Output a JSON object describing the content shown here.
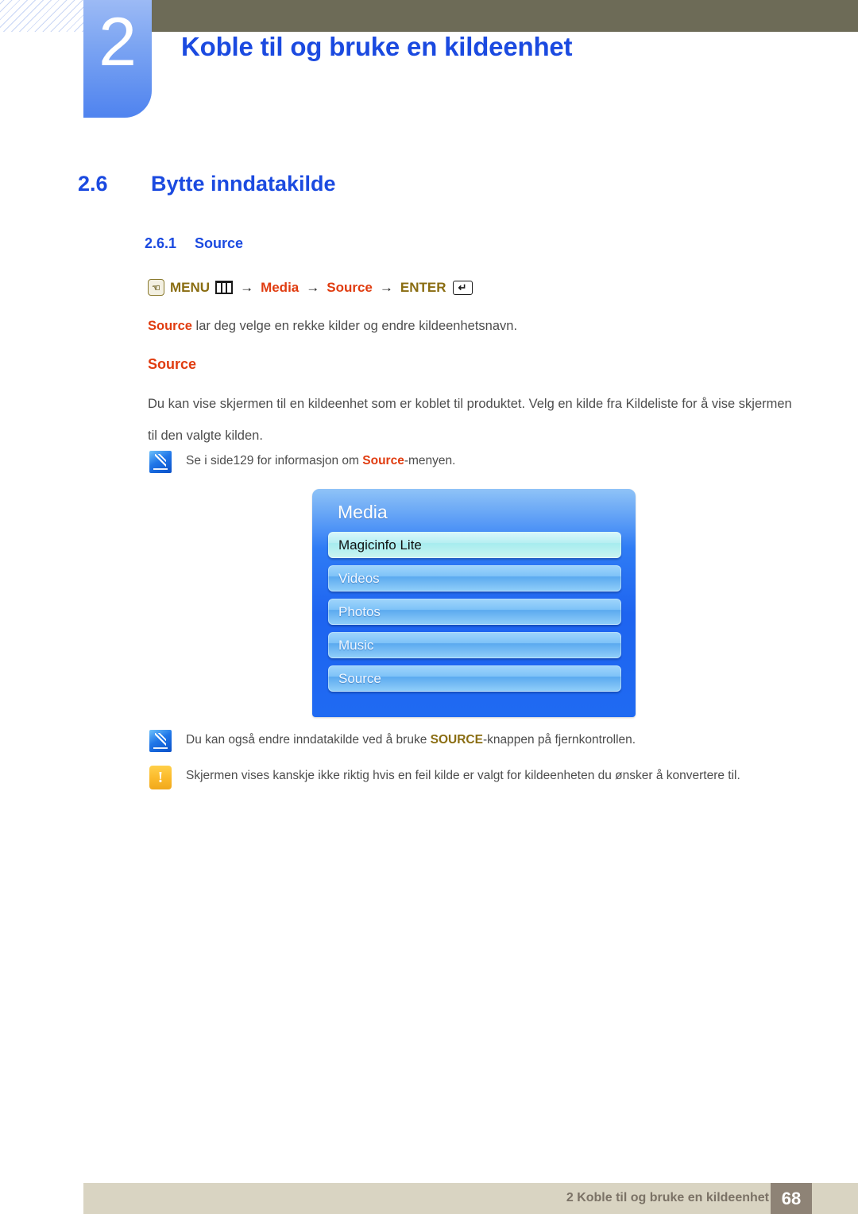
{
  "header": {
    "chapter_number": "2",
    "chapter_title": "Koble til og bruke en kildeenhet"
  },
  "sections": {
    "h2_number": "2.6",
    "h2_title": "Bytte inndatakilde",
    "h3_number": "2.6.1",
    "h3_title": "Source"
  },
  "menu_path": {
    "hand_icon": "hand-pointer-icon",
    "menu_label": "MENU",
    "menu_icon": "menu-bars-icon",
    "arrow1": "→",
    "media_label": "Media",
    "arrow2": "→",
    "source_label": "Source",
    "arrow3": "→",
    "enter_label": "ENTER",
    "enter_icon": "↵"
  },
  "body": {
    "intro_bold": "Source",
    "intro_rest": " lar deg velge en rekke kilder og endre kildeenhetsnavn.",
    "sub_heading": "Source",
    "paragraph": "Du kan vise skjermen til en kildeenhet som er koblet til produktet. Velg en kilde fra Kildeliste for å vise skjermen til den valgte kilden."
  },
  "notes": [
    {
      "icon": "note-pen-icon",
      "pre": "Se i side129 for informasjon om ",
      "bold": "Source",
      "post": "-menyen."
    },
    {
      "icon": "note-pen-icon",
      "pre": "Du kan også endre inndatakilde ved å bruke ",
      "bold": "SOURCE",
      "post": "-knappen på fjernkontrollen."
    },
    {
      "icon": "warning-exclamation-icon",
      "pre": "Skjermen vises kanskje ikke riktig hvis en feil kilde er valgt for kildeenheten du ønsker å konvertere til.",
      "bold": "",
      "post": ""
    }
  ],
  "osd": {
    "title": "Media",
    "items": [
      {
        "label": "Magicinfo Lite",
        "selected": true
      },
      {
        "label": "Videos",
        "selected": false
      },
      {
        "label": "Photos",
        "selected": false
      },
      {
        "label": "Music",
        "selected": false
      },
      {
        "label": "Source",
        "selected": false
      }
    ]
  },
  "footer": {
    "text": "2 Koble til og bruke en kildeenhet",
    "page_number": "68"
  },
  "colors": {
    "heading_blue": "#1b4ae0",
    "accent_red": "#e03c10",
    "accent_gold": "#8a6d12",
    "olive_bar": "#6d6b57",
    "footer_beige": "#d9d4c2",
    "page_box": "#8e8376",
    "osd_blue": "#1e64f0"
  }
}
